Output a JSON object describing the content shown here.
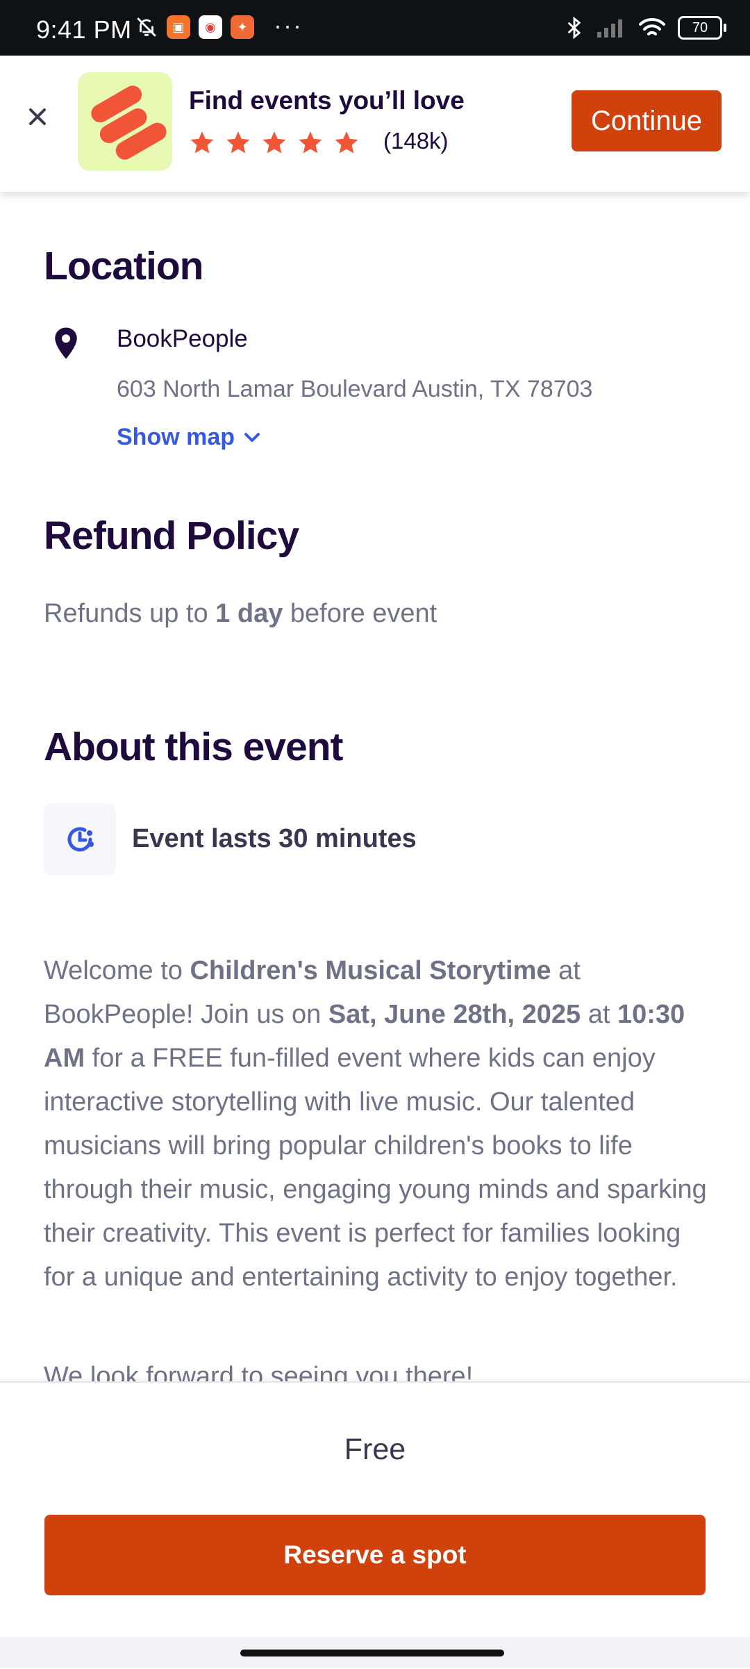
{
  "status_bar": {
    "time": "9:41 PM",
    "battery": "70"
  },
  "banner": {
    "title": "Find events you’ll love",
    "rating_count": "(148k)",
    "rating_stars": 5,
    "continue_label": "Continue"
  },
  "location": {
    "heading": "Location",
    "venue": "BookPeople",
    "address": "603 North Lamar Boulevard Austin, TX 78703",
    "show_map": "Show map"
  },
  "refund": {
    "heading": "Refund Policy",
    "text_before": "Refunds up to ",
    "text_bold": "1 day",
    "text_after": " before event"
  },
  "about": {
    "heading": "About this event",
    "duration": "Event lasts 30 minutes",
    "description": {
      "p1": "Welcome to ",
      "b1": "Children's Musical Storytime",
      "p2": " at BookPeople! Join us on ",
      "b2": "Sat, June 28th, 2025",
      "p3": " at ",
      "b3": "10:30 AM",
      "p4": " for a FREE fun-filled event where kids can enjoy interactive storytelling with live music. Our talented musicians will bring popular children's books to life through their music, engaging young minds and sparking their creativity. This event is perfect for families looking for a unique and entertaining activity to enjoy together."
    },
    "next_line": "We look forward to seeing you there!"
  },
  "footer": {
    "price": "Free",
    "reserve_label": "Reserve a spot"
  },
  "colors": {
    "brand_orange": "#d1410c",
    "link_blue": "#3659e3",
    "heading": "#1e0a3c",
    "body_text": "#6f7287"
  }
}
